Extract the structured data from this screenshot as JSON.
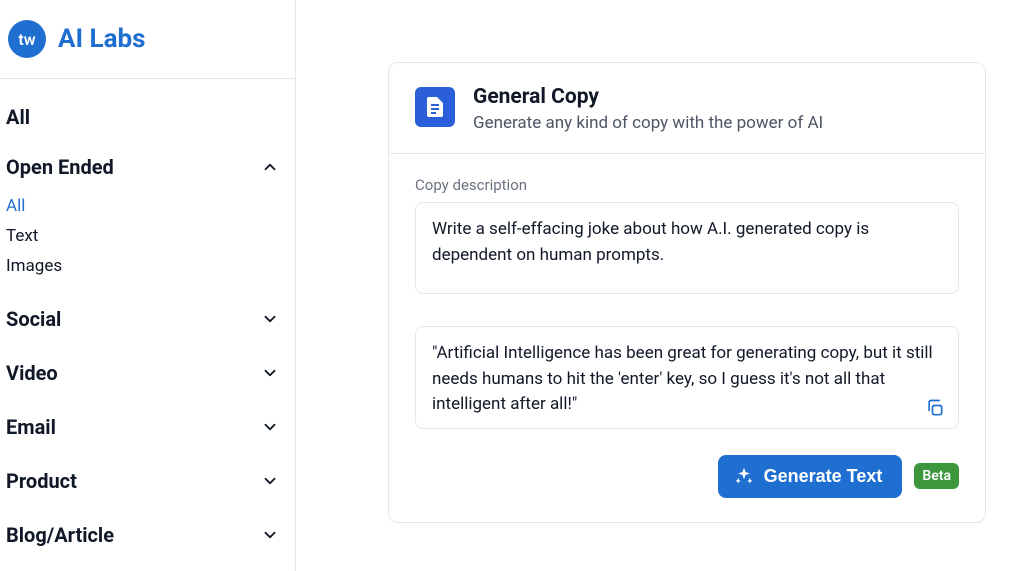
{
  "brand": {
    "logo_text": "tw",
    "name": "AI Labs"
  },
  "nav": {
    "top": "All",
    "groups": [
      {
        "label": "Open Ended",
        "expanded": true,
        "items": [
          "All",
          "Text",
          "Images"
        ],
        "active_index": 0
      },
      {
        "label": "Social",
        "expanded": false
      },
      {
        "label": "Video",
        "expanded": false
      },
      {
        "label": "Email",
        "expanded": false
      },
      {
        "label": "Product",
        "expanded": false
      },
      {
        "label": "Blog/Article",
        "expanded": false
      }
    ]
  },
  "card": {
    "title": "General Copy",
    "subtitle": "Generate any kind of copy with the power of AI",
    "field_label": "Copy description",
    "input_value": "Write a self-effacing joke about how A.I. generated copy is dependent on human prompts.",
    "output_value": "\"Artificial Intelligence has been great for generating copy, but it still needs humans to hit the 'enter' key, so I guess it's not all that intelligent after all!\"",
    "generate_label": "Generate Text",
    "beta_label": "Beta"
  }
}
